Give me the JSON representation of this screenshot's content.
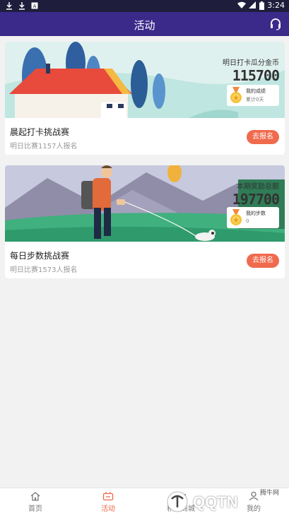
{
  "status_bar": {
    "time": "3:24"
  },
  "header": {
    "title": "活动"
  },
  "cards": [
    {
      "overlay_label": "明日打卡瓜分金币",
      "overlay_number": "115700",
      "mini_title": "我的成绩",
      "mini_value": "累计0天",
      "title": "晨起打卡挑战赛",
      "subtitle": "明日比赛1157人报名",
      "button": "去报名"
    },
    {
      "overlay_label": "本期奖励总额",
      "overlay_number": "197700",
      "mini_title": "我的步数",
      "mini_value": "0",
      "title": "每日步数挑战赛",
      "subtitle": "明日比赛1573人报名",
      "button": "去报名"
    }
  ],
  "tabbar": {
    "home": "首页",
    "activity": "活动",
    "points": "积分商城",
    "mine": "我的"
  },
  "watermark": {
    "text": "QQTN",
    "small": "腾牛网"
  },
  "colors": {
    "header": "#3b2a8a",
    "accent": "#f06a4e"
  }
}
